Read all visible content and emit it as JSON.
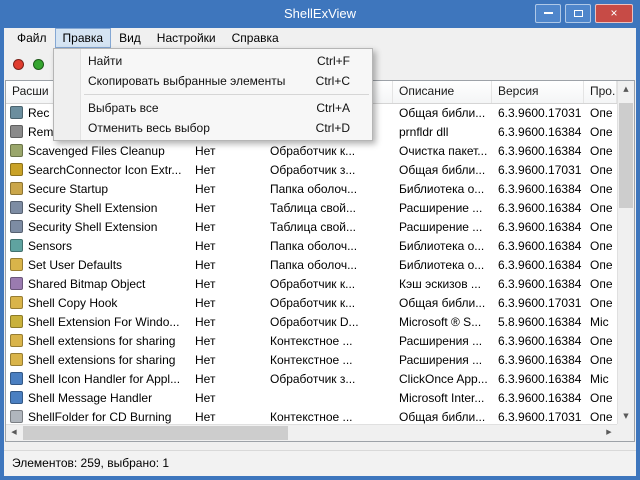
{
  "window": {
    "title": "ShellExView"
  },
  "titlebar": {
    "close_glyph": "×"
  },
  "menubar": {
    "items": [
      "Файл",
      "Правка",
      "Вид",
      "Настройки",
      "Справка"
    ],
    "active": "Правка"
  },
  "edit_menu": {
    "items": [
      {
        "label": "Найти",
        "shortcut": "Ctrl+F"
      },
      {
        "label": "Скопировать выбранные элементы",
        "shortcut": "Ctrl+C"
      },
      {
        "separator": true
      },
      {
        "label": "Выбрать все",
        "shortcut": "Ctrl+A"
      },
      {
        "label": "Отменить весь выбор",
        "shortcut": "Ctrl+D"
      }
    ]
  },
  "toolbar": {
    "buttons": [
      {
        "name": "disable-selected-icon",
        "color": "#e03c2e"
      },
      {
        "name": "enable-selected-icon",
        "color": "#35a52f"
      }
    ]
  },
  "table": {
    "columns": [
      {
        "label": "Расши"
      },
      {
        "label": ""
      },
      {
        "label": ""
      },
      {
        "label": "Описание"
      },
      {
        "label": "Версия"
      },
      {
        "label": "Про..."
      }
    ],
    "rows": [
      {
        "icon_name": "recycle-icon",
        "icon_color": "#6b8e9e",
        "name": "Rec",
        "disabled": "",
        "type": "",
        "description": "Общая библи...",
        "version": "6.3.9600.17031",
        "product": "Опе"
      },
      {
        "icon_name": "printer-icon",
        "icon_color": "#8a8a8a",
        "name": "Rem",
        "disabled": "",
        "type": "",
        "description": "prnfldr dll",
        "version": "6.3.9600.16384",
        "product": "Опе"
      },
      {
        "icon_name": "cleanup-icon",
        "icon_color": "#9aa66b",
        "name": "Scavenged Files Cleanup",
        "disabled": "Нет",
        "type": "Обработчик к...",
        "description": "Очистка пакет...",
        "version": "6.3.9600.16384",
        "product": "Опе"
      },
      {
        "icon_name": "search-icon",
        "icon_color": "#c9a227",
        "name": "SearchConnector Icon Extr...",
        "disabled": "Нет",
        "type": "Обработчик з...",
        "description": "Общая библи...",
        "version": "6.3.9600.17031",
        "product": "Опе"
      },
      {
        "icon_name": "lock-icon",
        "icon_color": "#caa64a",
        "name": "Secure Startup",
        "disabled": "Нет",
        "type": "Папка оболоч...",
        "description": "Библиотека о...",
        "version": "6.3.9600.16384",
        "product": "Опе"
      },
      {
        "icon_name": "properties-icon",
        "icon_color": "#7d8ca3",
        "name": "Security Shell Extension",
        "disabled": "Нет",
        "type": "Таблица свой...",
        "description": "Расширение ...",
        "version": "6.3.9600.16384",
        "product": "Опе"
      },
      {
        "icon_name": "properties-icon",
        "icon_color": "#7d8ca3",
        "name": "Security Shell Extension",
        "disabled": "Нет",
        "type": "Таблица свой...",
        "description": "Расширение ...",
        "version": "6.3.9600.16384",
        "product": "Опе"
      },
      {
        "icon_name": "sensor-icon",
        "icon_color": "#5fa3a0",
        "name": "Sensors",
        "disabled": "Нет",
        "type": "Папка оболоч...",
        "description": "Библиотека о...",
        "version": "6.3.9600.16384",
        "product": "Опе"
      },
      {
        "icon_name": "folder-icon",
        "icon_color": "#d9b44a",
        "name": "Set User Defaults",
        "disabled": "Нет",
        "type": "Папка оболоч...",
        "description": "Библиотека о...",
        "version": "6.3.9600.16384",
        "product": "Опе"
      },
      {
        "icon_name": "image-icon",
        "icon_color": "#9a7bb0",
        "name": "Shared Bitmap Object",
        "disabled": "Нет",
        "type": "Обработчик к...",
        "description": "Кэш эскизов ...",
        "version": "6.3.9600.16384",
        "product": "Опе"
      },
      {
        "icon_name": "folder-icon",
        "icon_color": "#d9b44a",
        "name": "Shell Copy Hook",
        "disabled": "Нет",
        "type": "Обработчик к...",
        "description": "Общая библи...",
        "version": "6.3.9600.17031",
        "product": "Опе"
      },
      {
        "icon_name": "script-icon",
        "icon_color": "#c9b13b",
        "name": "Shell Extension For Windo...",
        "disabled": "Нет",
        "type": "Обработчик D...",
        "description": "Microsoft ® S...",
        "version": "5.8.9600.16384",
        "product": "Mic"
      },
      {
        "icon_name": "share-folder-icon",
        "icon_color": "#d9b44a",
        "name": "Shell extensions for sharing",
        "disabled": "Нет",
        "type": "Контекстное ...",
        "description": "Расширения ...",
        "version": "6.3.9600.16384",
        "product": "Опе"
      },
      {
        "icon_name": "share-folder-icon",
        "icon_color": "#d9b44a",
        "name": "Shell extensions for sharing",
        "disabled": "Нет",
        "type": "Контекстное ...",
        "description": "Расширения ...",
        "version": "6.3.9600.16384",
        "product": "Опе"
      },
      {
        "icon_name": "app-icon",
        "icon_color": "#4a7fc1",
        "name": "Shell Icon Handler for Appl...",
        "disabled": "Нет",
        "type": "Обработчик з...",
        "description": "ClickOnce App...",
        "version": "6.3.9600.16384",
        "product": "Mic"
      },
      {
        "icon_name": "message-icon",
        "icon_color": "#4a7fc1",
        "name": "Shell Message Handler",
        "disabled": "Нет",
        "type": "",
        "description": "Microsoft Inter...",
        "version": "6.3.9600.16384",
        "product": "Опе"
      },
      {
        "icon_name": "cd-icon",
        "icon_color": "#b0b6bd",
        "name": "ShellFolder for CD Burning",
        "disabled": "Нет",
        "type": "Контекстное ...",
        "description": "Общая библи...",
        "version": "6.3.9600.17031",
        "product": "Опе"
      }
    ]
  },
  "statusbar": {
    "text": "Элементов: 259, выбрано: 1"
  },
  "scrollbar": {
    "up": "▲",
    "down": "▼",
    "left": "◀",
    "right": "▶"
  },
  "colors": {
    "titlebar": "#3e76bd",
    "close_button": "#c74b46",
    "menu_highlight": "#d5e4f3"
  }
}
